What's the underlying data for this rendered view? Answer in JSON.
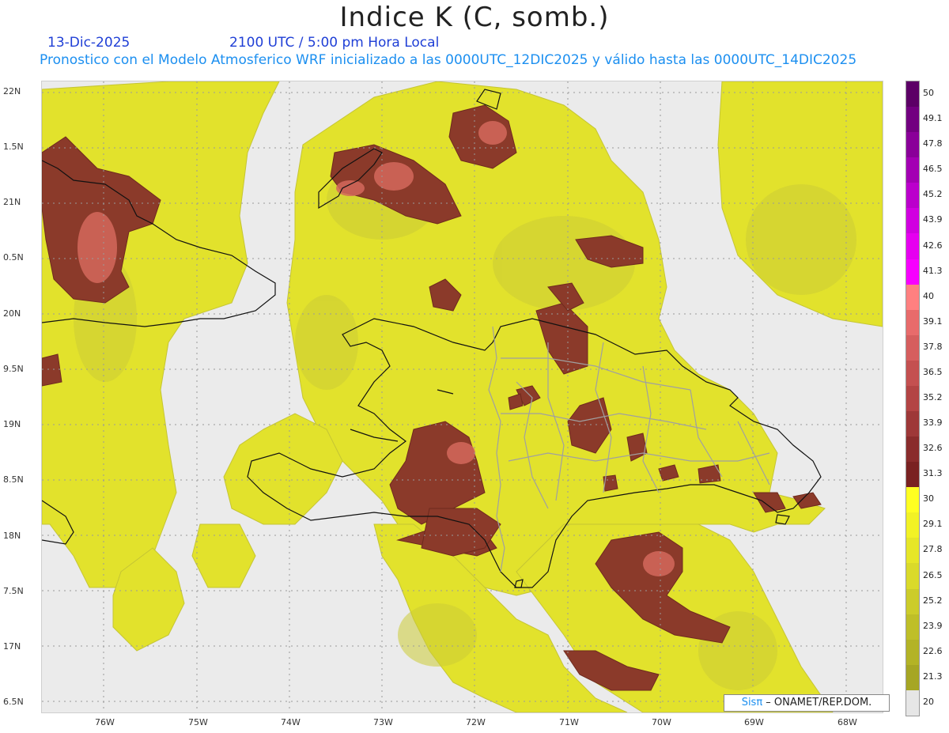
{
  "header": {
    "title": "Indice K (C, somb.)",
    "date": "13-Dic-2025",
    "time": "2100 UTC / 5:00 pm Hora Local",
    "description": "Pronostico con el Modelo Atmosferico WRF inicializado a las 0000UTC_12DIC2025 y válido hasta las  0000UTC_14DIC2025"
  },
  "map": {
    "lat_labels": [
      "22N",
      "1.5N",
      "21N",
      "0.5N",
      "20N",
      "9.5N",
      "19N",
      "8.5N",
      "18N",
      "7.5N",
      "17N",
      "6.5N"
    ],
    "lon_labels": [
      "76W",
      "75W",
      "74W",
      "73W",
      "72W",
      "71W",
      "70W",
      "69W",
      "68W"
    ]
  },
  "credit": {
    "prefix": "Sisπ",
    "text": " – ONAMET/REP.DOM."
  },
  "legend": {
    "labels": [
      "50",
      "49.1",
      "47.8",
      "46.5",
      "45.2",
      "43.9",
      "42.6",
      "41.3",
      "40",
      "39.1",
      "37.8",
      "36.5",
      "35.2",
      "33.9",
      "32.6",
      "31.3",
      "30",
      "29.1",
      "27.8",
      "26.5",
      "25.2",
      "23.9",
      "22.6",
      "21.3",
      "20"
    ],
    "colors": [
      "#5c0066",
      "#720080",
      "#8a0099",
      "#a300b3",
      "#bb00cc",
      "#d100e0",
      "#e600f0",
      "#f700ff",
      "#ff8080",
      "#e86b6b",
      "#d65e5e",
      "#c45050",
      "#b34444",
      "#9e3838",
      "#8a2c2c",
      "#7a2222",
      "#ffff22",
      "#f2f225",
      "#e6e628",
      "#dada2a",
      "#cccc2a",
      "#bfbf28",
      "#b3b326",
      "#a6a624",
      "#e6e6e6"
    ]
  },
  "colors": {
    "low": "#e6e6e6",
    "yellow": "#e4e42a",
    "olive": "#c8c83a",
    "brown": "#8b3a2a",
    "salmon": "#d4685c"
  }
}
